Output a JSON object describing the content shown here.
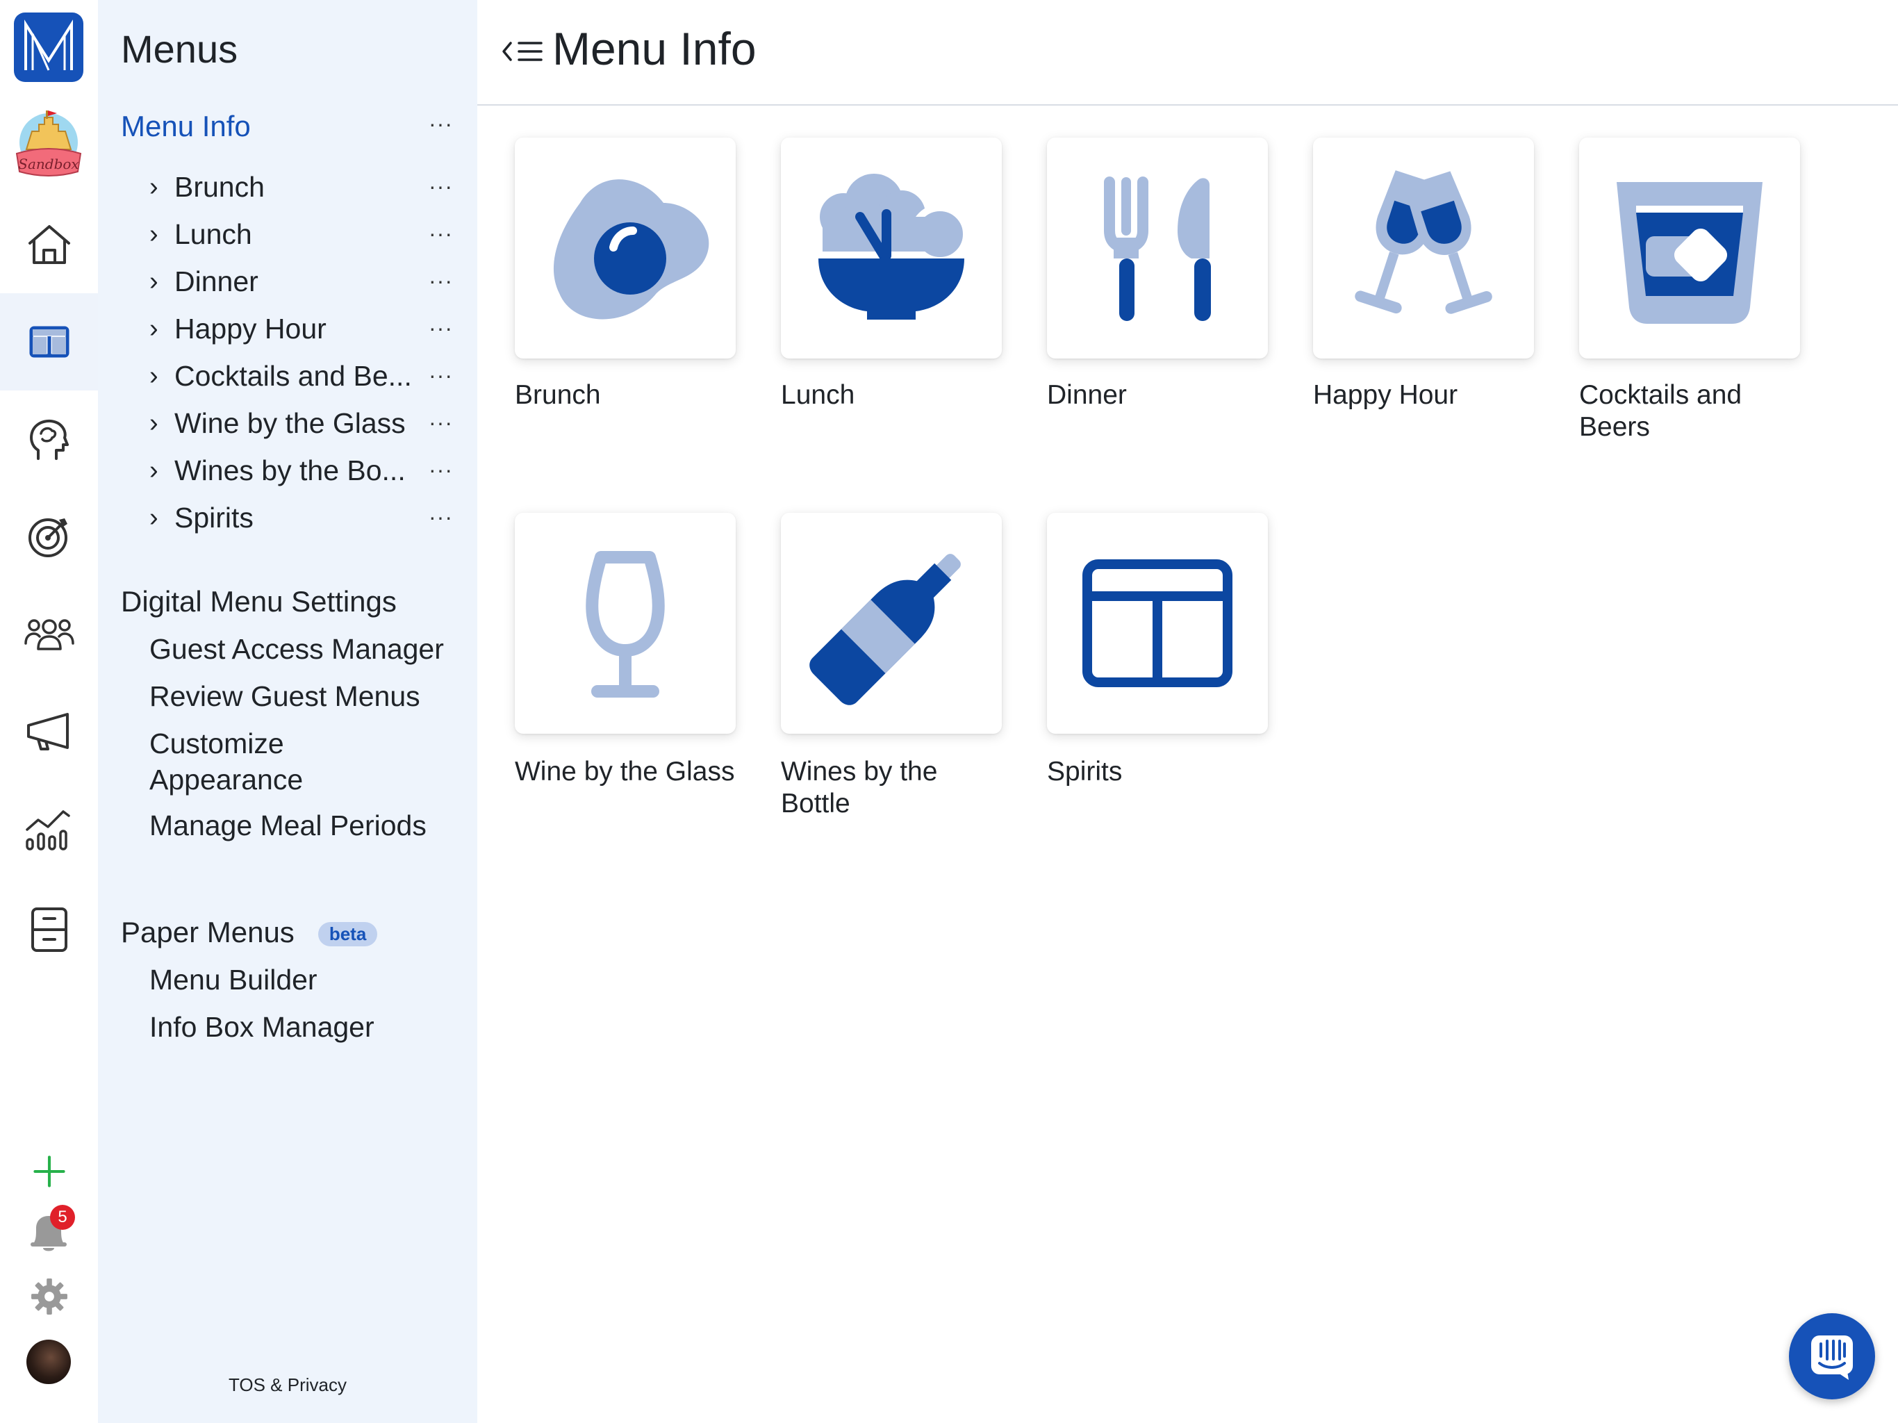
{
  "colors": {
    "primary": "#1652b8",
    "light": "#a7bbdd",
    "sidebar_bg": "#eef4fc",
    "badge": "#e0202a",
    "add": "#27b14a"
  },
  "rail": {
    "logo_icon": "m-logo-icon",
    "sandbox_label": "Sandbox",
    "notifications_count": "5"
  },
  "sidebar": {
    "title": "Menus",
    "menu_info": "Menu Info",
    "menu_items": [
      {
        "label": "Brunch"
      },
      {
        "label": "Lunch"
      },
      {
        "label": "Dinner"
      },
      {
        "label": "Happy Hour"
      },
      {
        "label": "Cocktails and Be..."
      },
      {
        "label": "Wine by the Glass"
      },
      {
        "label": "Wines by the Bo..."
      },
      {
        "label": "Spirits"
      }
    ],
    "more_glyph": "···",
    "digital_settings": {
      "title": "Digital Menu Settings",
      "links": [
        "Guest Access Manager",
        "Review Guest Menus",
        "Customize Appearance",
        "Manage Meal Periods"
      ]
    },
    "paper_menus": {
      "title": "Paper Menus",
      "badge": "beta",
      "links": [
        "Menu Builder",
        "Info Box Manager"
      ]
    },
    "footer": "TOS & Privacy"
  },
  "main": {
    "title": "Menu Info",
    "cards": [
      {
        "label": "Brunch",
        "icon": "fried-egg-icon"
      },
      {
        "label": "Lunch",
        "icon": "salad-bowl-icon"
      },
      {
        "label": "Dinner",
        "icon": "fork-knife-icon"
      },
      {
        "label": "Happy Hour",
        "icon": "cheers-glasses-icon"
      },
      {
        "label": "Cocktails and Beers",
        "icon": "rocks-glass-icon"
      },
      {
        "label": "Wine by the Glass",
        "icon": "wine-glass-icon"
      },
      {
        "label": "Wines by the Bottle",
        "icon": "wine-bottle-icon"
      },
      {
        "label": "Spirits",
        "icon": "table-layout-icon"
      }
    ]
  }
}
